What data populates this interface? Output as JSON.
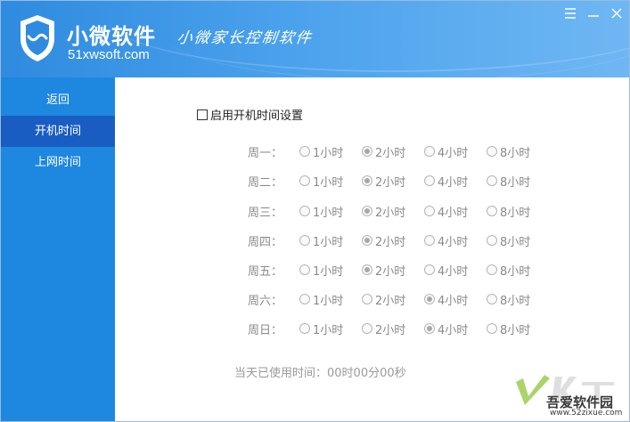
{
  "header": {
    "app_name": "小微软件",
    "domain": "51xwsoft.com",
    "slogan": "小微家长控制软件",
    "icons": {
      "logo": "shield-wave-icon",
      "menu": "menu-icon",
      "minimize": "minimize-icon",
      "close": "close-icon"
    }
  },
  "sidebar": {
    "items": [
      {
        "label": "返回",
        "active": false
      },
      {
        "label": "开机时间",
        "active": true
      },
      {
        "label": "上网时间",
        "active": false
      }
    ]
  },
  "main": {
    "enable_label": "启用开机时间设置",
    "enable_checked": false,
    "days": [
      {
        "label": "周一：",
        "selected": "2小时"
      },
      {
        "label": "周二：",
        "selected": "2小时"
      },
      {
        "label": "周三：",
        "selected": "2小时"
      },
      {
        "label": "周四：",
        "selected": "2小时"
      },
      {
        "label": "周五：",
        "selected": "2小时"
      },
      {
        "label": "周六：",
        "selected": "4小时"
      },
      {
        "label": "周日：",
        "selected": "4小时"
      }
    ],
    "options": [
      "1小时",
      "2小时",
      "4小时",
      "8小时"
    ],
    "used_time": "当天已使用时间：00时00分00秒"
  },
  "watermark": {
    "title": "吾爱软件园",
    "url": "www.52zixue.com"
  },
  "colors": {
    "header_start": "#2f8bdf",
    "header_end": "#6fb7f3",
    "sidebar": "#1e87e0",
    "sidebar_active": "#1a5dc2"
  }
}
